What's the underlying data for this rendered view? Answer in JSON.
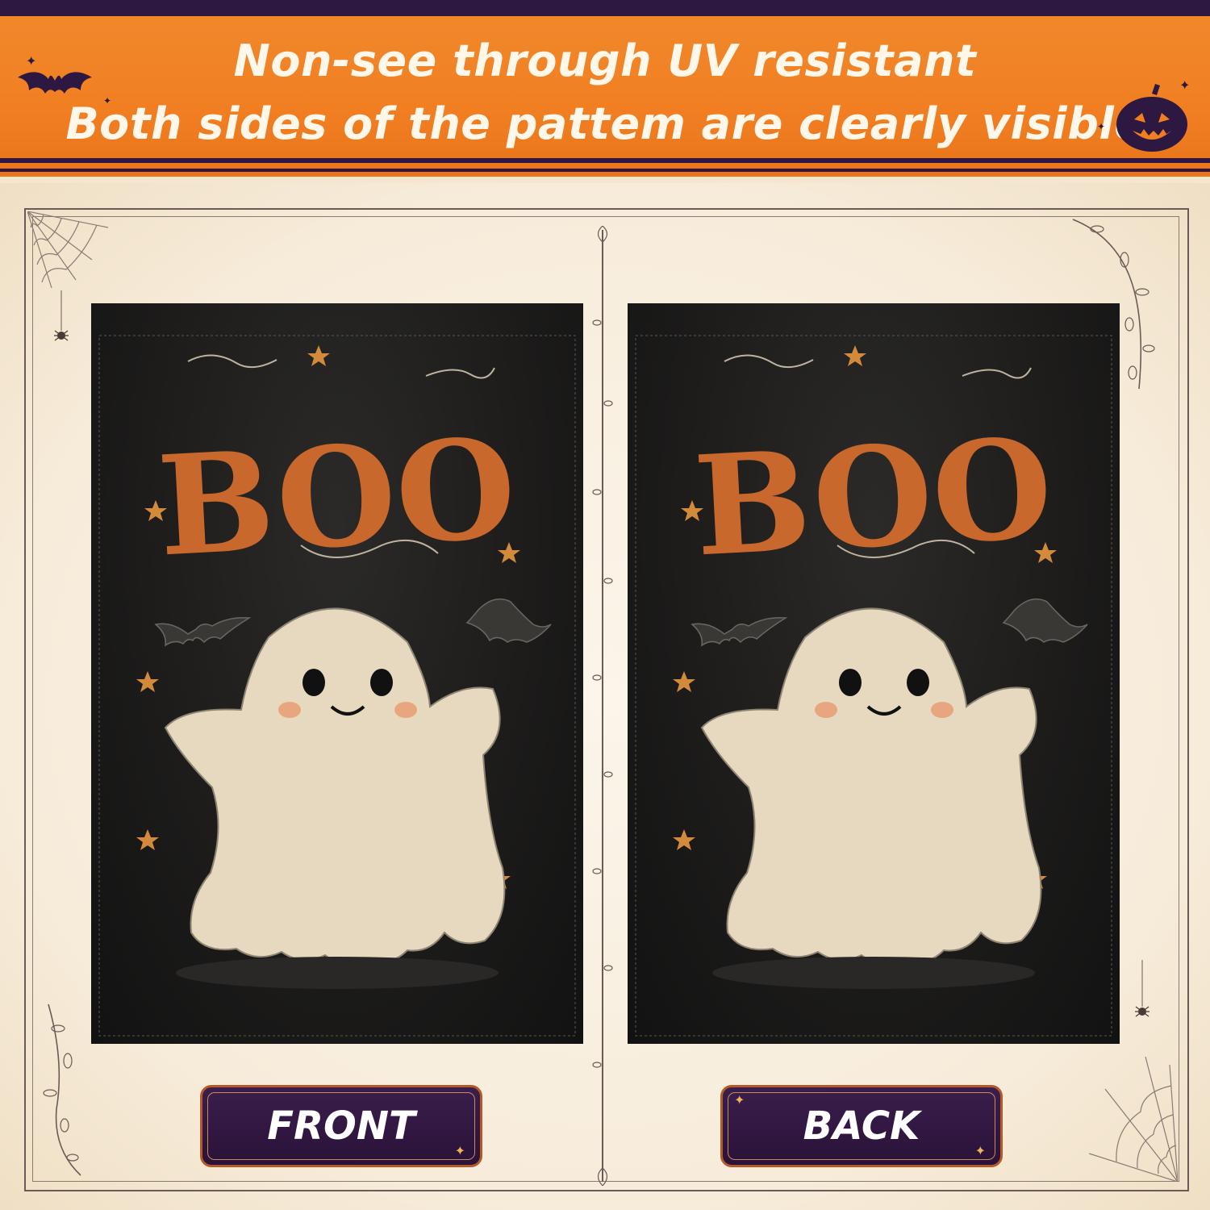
{
  "banner": {
    "line1": "Non-see through UV resistant",
    "line2": "Both sides of the pattem are clearly visible"
  },
  "flags": [
    {
      "side": "front",
      "word": "BOO"
    },
    {
      "side": "back",
      "word": "BOO"
    }
  ],
  "labels": {
    "front": "FRONT",
    "back": "BACK"
  },
  "colors": {
    "banner": "#f17f22",
    "banner_stripe": "#2c1840",
    "paper": "#f8f0e1",
    "flag": "#1b1a19",
    "boo": "#c9682c",
    "ghost": "#e9dcc3",
    "label_bg": "#2e163d",
    "label_border": "#b45a2a"
  },
  "icons": [
    "bat-icon",
    "pumpkin-icon",
    "spider-web-icon",
    "spider-icon",
    "vine-icon",
    "ghost-illustration",
    "bat-illustration",
    "star-icon"
  ]
}
